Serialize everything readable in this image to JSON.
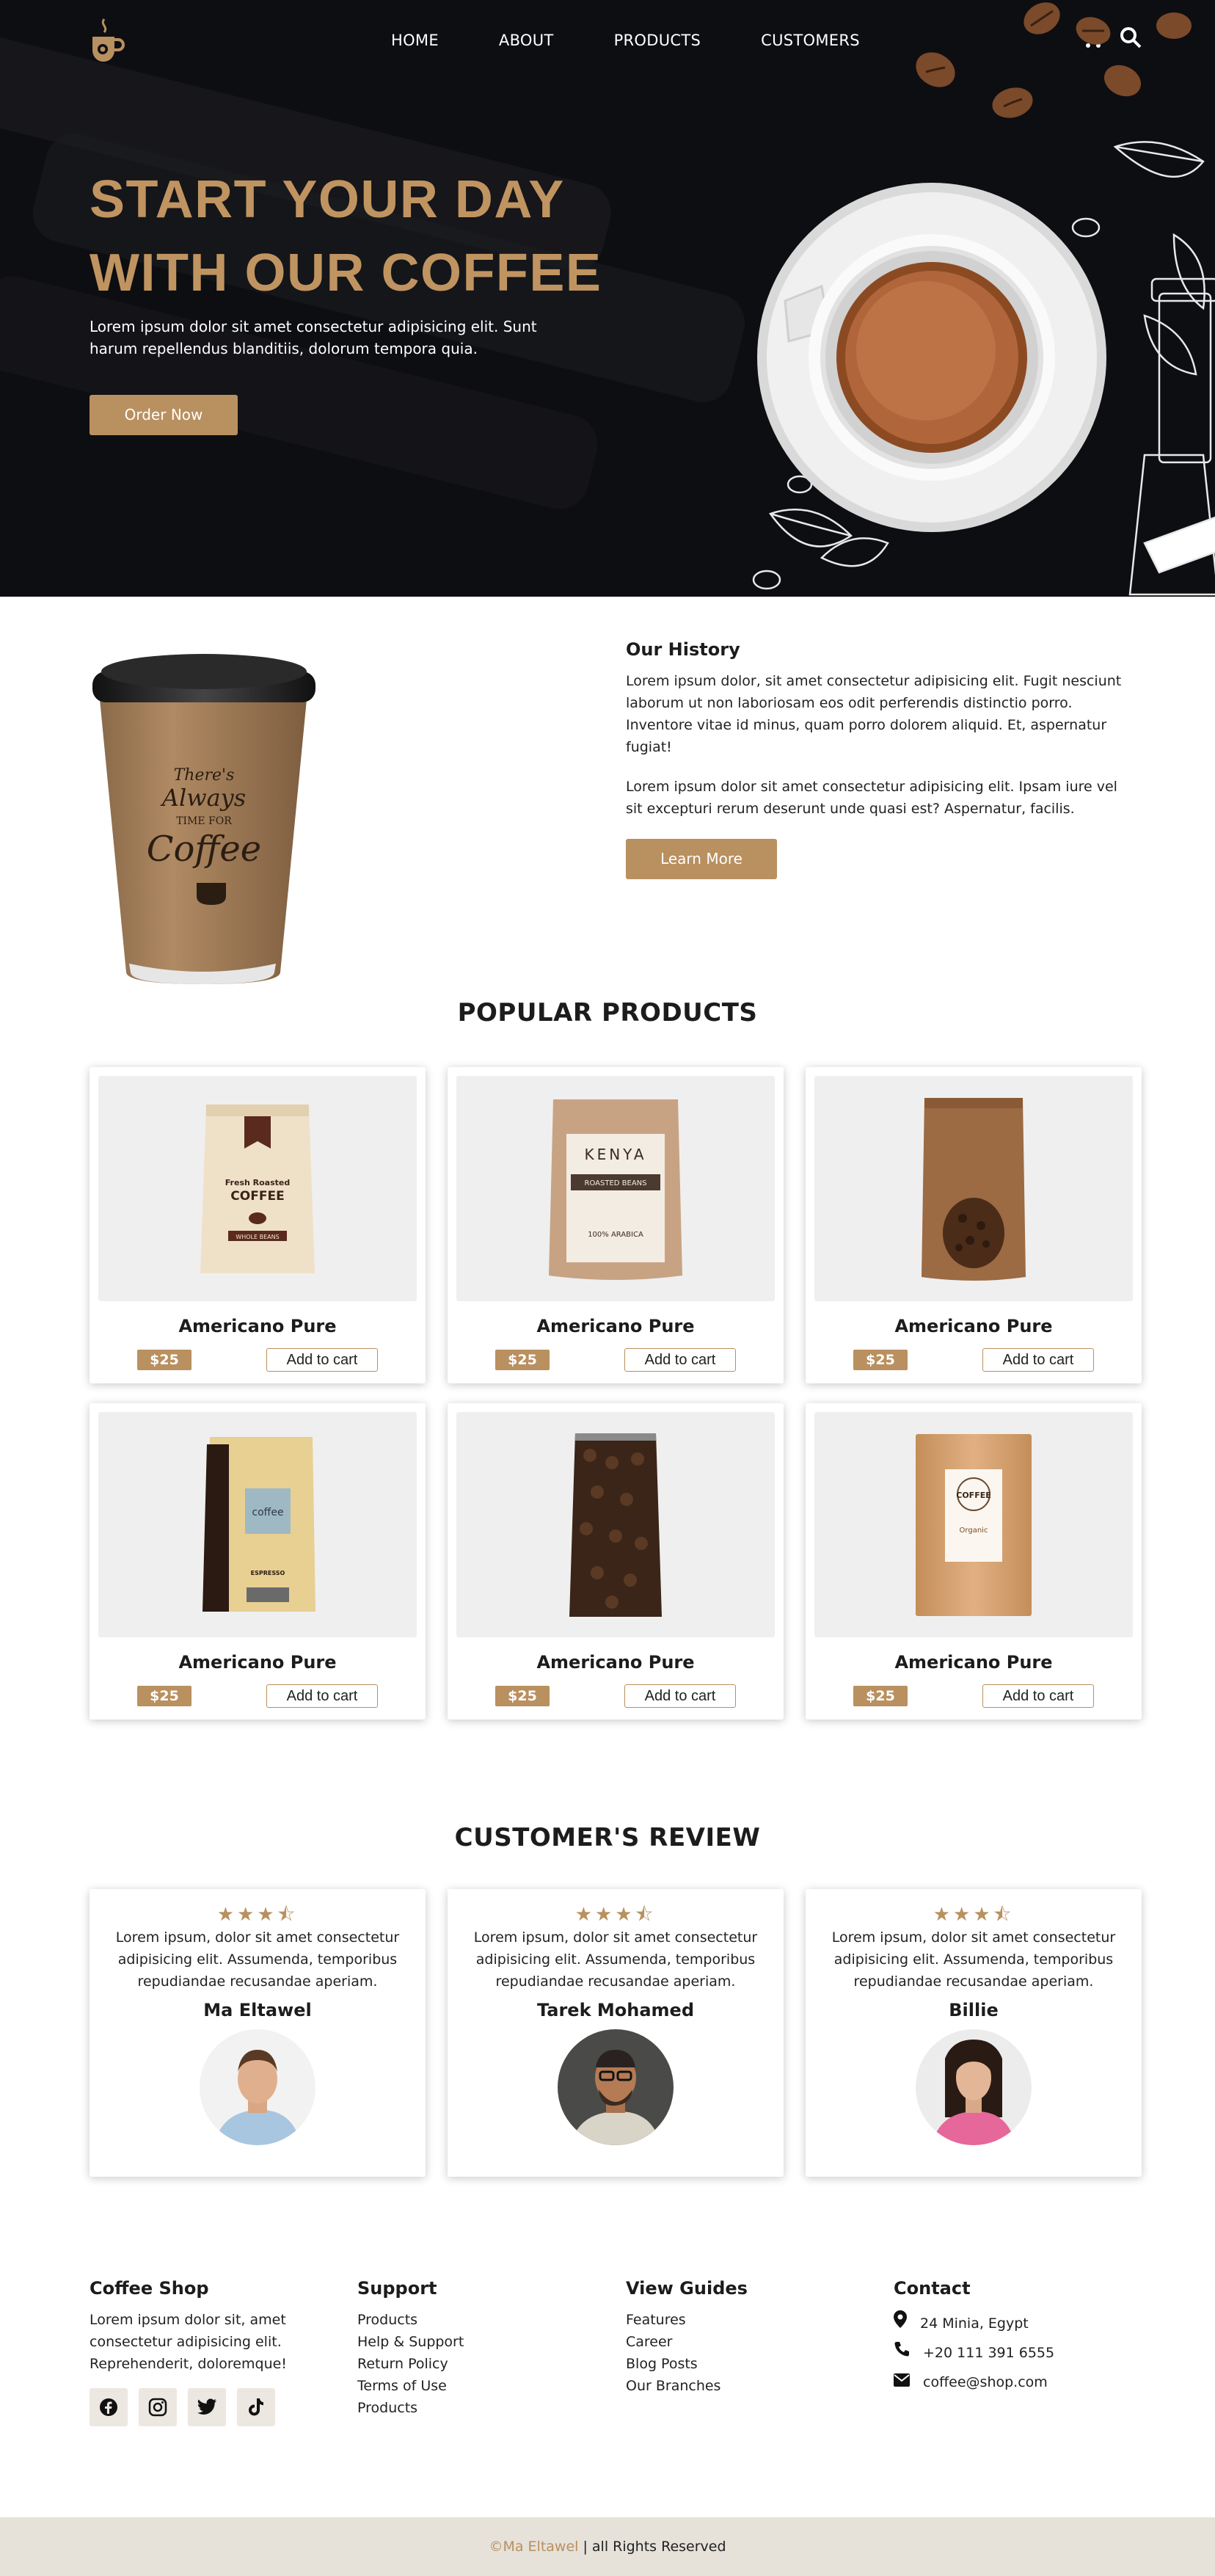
{
  "colors": {
    "accent": "#b9905f",
    "hero_bg": "#0d0e12",
    "title_gold": "#c09460"
  },
  "nav": {
    "items": [
      "HOME",
      "ABOUT",
      "PRODUCTS",
      "CUSTOMERS"
    ],
    "icons": [
      "cart-icon",
      "search-icon"
    ]
  },
  "hero": {
    "title_line1": "START YOUR DAY",
    "title_line2": "WITH OUR COFFEE",
    "text": "Lorem ipsum dolor sit amet consectetur adipisicing elit. Sunt harum repellendus blanditiis, dolorum tempora quia.",
    "button": "Order Now"
  },
  "history": {
    "cup_text_1": "There's",
    "cup_text_2": "Always",
    "cup_text_3": "TIME FOR",
    "cup_text_4": "Coffee",
    "title": "Our History",
    "p1": "Lorem ipsum dolor, sit amet consectetur adipisicing elit. Fugit nesciunt laborum ut non laboriosam eos odit perferendis distinctio porro. Inventore vitae id minus, quam porro dolorem aliquid. Et, aspernatur fugiat!",
    "p2": "Lorem ipsum dolor sit amet consectetur adipisicing elit. Ipsam iure vel sit excepturi rerum deserunt unde quasi est? Aspernatur, facilis.",
    "button": "Learn More"
  },
  "products": {
    "title": "POPULAR PRODUCTS",
    "items": [
      {
        "name": "Americano Pure",
        "price": "$25",
        "cart": "Add to cart",
        "label1": "Fresh Roasted",
        "label2": "COFFEE",
        "label3": "WHOLE BEANS"
      },
      {
        "name": "Americano Pure",
        "price": "$25",
        "cart": "Add to cart",
        "label1": "KENYA",
        "label2": "ROASTED BEANS",
        "label3": "100% ARABICA"
      },
      {
        "name": "Americano Pure",
        "price": "$25",
        "cart": "Add to cart"
      },
      {
        "name": "Americano Pure",
        "price": "$25",
        "cart": "Add to cart",
        "label1": "coffee",
        "label2": "ESPRESSO"
      },
      {
        "name": "Americano Pure",
        "price": "$25",
        "cart": "Add to cart"
      },
      {
        "name": "Americano Pure",
        "price": "$25",
        "cart": "Add to cart",
        "label1": "COFFEE",
        "label2": "Organic"
      }
    ]
  },
  "reviews": {
    "title": "CUSTOMER'S REVIEW",
    "items": [
      {
        "rating": 3.5,
        "stars": "★★★⯪",
        "text": "Lorem ipsum, dolor sit amet consectetur adipisicing elit. Assumenda, temporibus repudiandae recusandae aperiam.",
        "name": "Ma Eltawel"
      },
      {
        "rating": 3.5,
        "stars": "★★★⯪",
        "text": "Lorem ipsum, dolor sit amet consectetur adipisicing elit. Assumenda, temporibus repudiandae recusandae aperiam.",
        "name": "Tarek Mohamed"
      },
      {
        "rating": 3.5,
        "stars": "★★★⯪",
        "text": "Lorem ipsum, dolor sit amet consectetur adipisicing elit. Assumenda, temporibus repudiandae recusandae aperiam.",
        "name": "Billie"
      }
    ]
  },
  "footer": {
    "shop": {
      "title": "Coffee Shop",
      "text": "Lorem ipsum dolor sit, amet consectetur adipisicing elit. Reprehenderit, doloremque!",
      "socials": [
        "facebook-icon",
        "instagram-icon",
        "twitter-icon",
        "tiktok-icon"
      ]
    },
    "support": {
      "title": "Support",
      "links": [
        "Products",
        "Help & Support",
        "Return Policy",
        "Terms of Use",
        "Products"
      ]
    },
    "guides": {
      "title": "View Guides",
      "links": [
        "Features",
        "Career",
        "Blog Posts",
        "Our Branches"
      ]
    },
    "contact": {
      "title": "Contact",
      "address": "24 Minia, Egypt",
      "phone": "+20 111 391 6555",
      "email": "coffee@shop.com"
    }
  },
  "copyright": {
    "symbol": "©",
    "name": "Ma Eltawel",
    "rest": " | all Rights Reserved"
  }
}
